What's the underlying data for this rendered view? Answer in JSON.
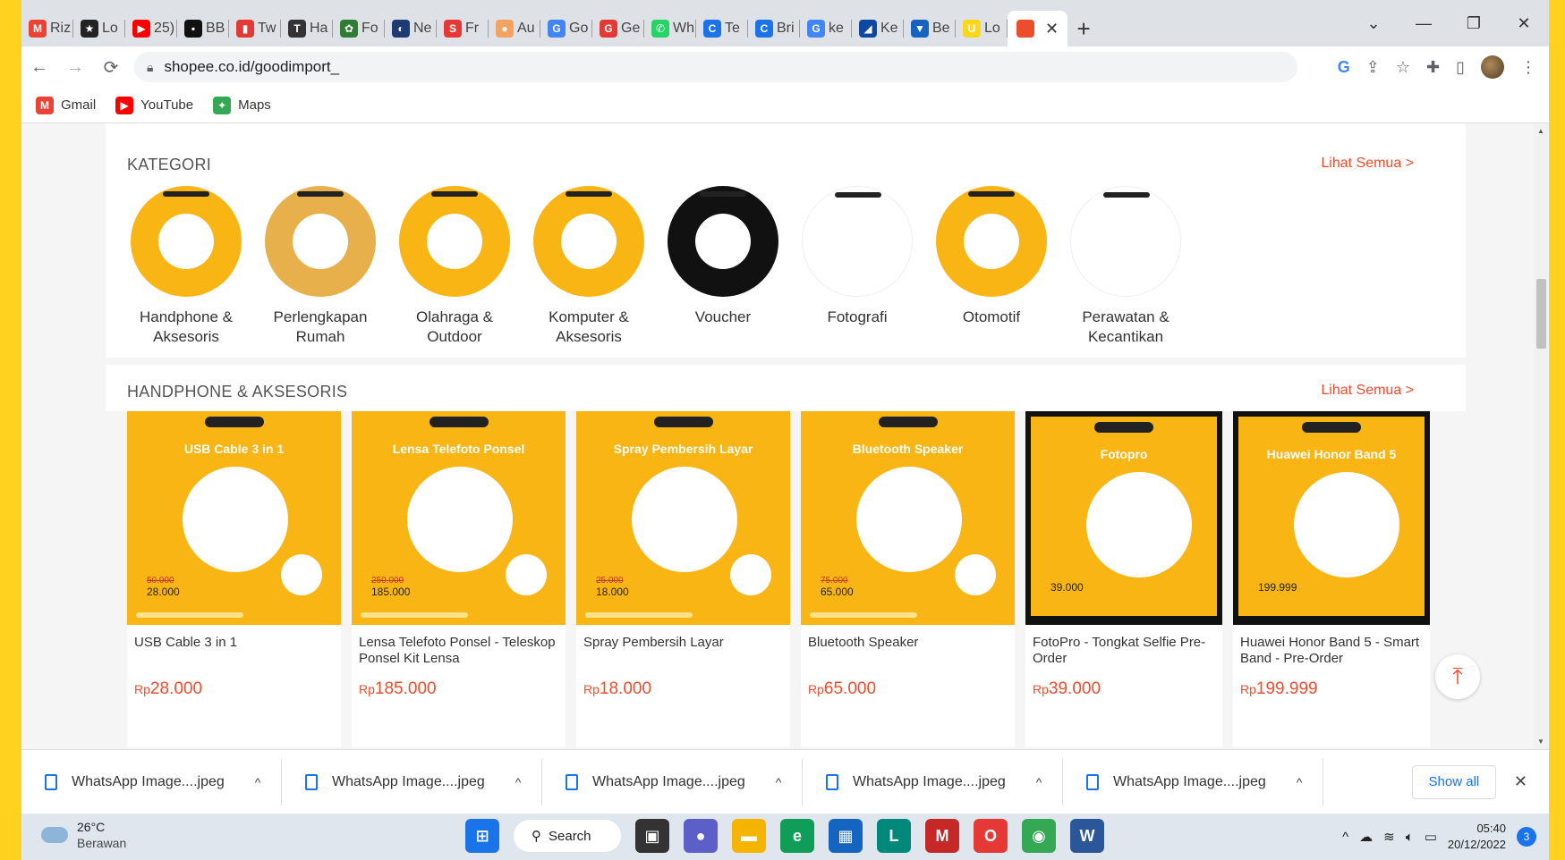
{
  "browser": {
    "tabs": [
      {
        "label": "Riz",
        "icon": "gmail-icon",
        "color": "#EA4335",
        "glyph": "M"
      },
      {
        "label": "Lo",
        "icon": "star-icon",
        "color": "#222222",
        "glyph": "★"
      },
      {
        "label": "25)",
        "icon": "youtube-icon",
        "color": "#FF0000",
        "glyph": "▶"
      },
      {
        "label": "BB",
        "icon": "bbc-icon",
        "color": "#111111",
        "glyph": "▪"
      },
      {
        "label": "Tw",
        "icon": "chart-icon",
        "color": "#E53935",
        "glyph": "▮"
      },
      {
        "label": "Ha",
        "icon": "t-icon",
        "color": "#333333",
        "glyph": "T"
      },
      {
        "label": "Fo",
        "icon": "fo-icon",
        "color": "#2E7D32",
        "glyph": "✿"
      },
      {
        "label": "Ne",
        "icon": "ne-icon",
        "color": "#1F3B73",
        "glyph": "◐"
      },
      {
        "label": "Fr",
        "icon": "s-icon",
        "color": "#E53935",
        "glyph": "S"
      },
      {
        "label": "Au",
        "icon": "au-icon",
        "color": "#F4A261",
        "glyph": "●"
      },
      {
        "label": "Go",
        "icon": "translate-icon",
        "color": "#4285F4",
        "glyph": "G"
      },
      {
        "label": "Ge",
        "icon": "ge-icon",
        "color": "#E53935",
        "glyph": "G"
      },
      {
        "label": "Wh",
        "icon": "whatsapp-icon",
        "color": "#25D366",
        "glyph": "✆"
      },
      {
        "label": "Te",
        "icon": "te-icon",
        "color": "#1A73E8",
        "glyph": "C"
      },
      {
        "label": "Bri",
        "icon": "bri-icon",
        "color": "#1A73E8",
        "glyph": "C"
      },
      {
        "label": "ke",
        "icon": "google-icon",
        "color": "#4285F4",
        "glyph": "G"
      },
      {
        "label": "Ke",
        "icon": "ke-icon",
        "color": "#0D47A1",
        "glyph": "◢"
      },
      {
        "label": "Be",
        "icon": "be-icon",
        "color": "#1565C0",
        "glyph": "▼"
      },
      {
        "label": "Lo",
        "icon": "lo-icon",
        "color": "#F9D71C",
        "glyph": "U"
      }
    ],
    "active_tab": {
      "icon": "shopee-icon",
      "color": "#EE4D2D"
    },
    "url": "shopee.co.id/goodimport_",
    "bookmarks": [
      {
        "label": "Gmail",
        "icon": "gmail-icon",
        "color": "#EA4335",
        "glyph": "M"
      },
      {
        "label": "YouTube",
        "icon": "youtube-icon",
        "color": "#FF0000",
        "glyph": "▶"
      },
      {
        "label": "Maps",
        "icon": "maps-icon",
        "color": "#34A853",
        "glyph": "✦"
      }
    ]
  },
  "kategori": {
    "title": "KATEGORI",
    "more": "Lihat Semua >",
    "items": [
      {
        "line1": "Handphone &",
        "line2": "Aksesoris",
        "bg": "#F9B514"
      },
      {
        "line1": "Perlengkapan",
        "line2": "Rumah",
        "bg": "#E7B04A"
      },
      {
        "line1": "Olahraga &",
        "line2": "Outdoor",
        "bg": "#F9B514"
      },
      {
        "line1": "Komputer &",
        "line2": "Aksesoris",
        "bg": "#F9B514"
      },
      {
        "line1": "Voucher",
        "line2": "",
        "bg": "#111111"
      },
      {
        "line1": "Fotografi",
        "line2": "",
        "bg": "#FFFFFF"
      },
      {
        "line1": "Otomotif",
        "line2": "",
        "bg": "#F9B514"
      },
      {
        "line1": "Perawatan &",
        "line2": "Kecantikan",
        "bg": "#FFFFFF"
      }
    ]
  },
  "products_section": {
    "title": "HANDPHONE & AKSESORIS",
    "more": "Lihat Semua >",
    "items": [
      {
        "img_title": "USB Cable 3 in 1",
        "old": "50.000",
        "new": "28.000",
        "name": "USB Cable 3 in 1",
        "currency": "Rp",
        "price": "28.000",
        "framed": false
      },
      {
        "img_title": "Lensa Telefoto Ponsel",
        "old": "250.000",
        "new": "185.000",
        "name": "Lensa Telefoto Ponsel - Teleskop Ponsel Kit Lensa",
        "currency": "Rp",
        "price": "185.000",
        "framed": false
      },
      {
        "img_title": "Spray Pembersih Layar",
        "old": "25.000",
        "new": "18.000",
        "name": "Spray Pembersih Layar",
        "currency": "Rp",
        "price": "18.000",
        "framed": false
      },
      {
        "img_title": "Bluetooth Speaker",
        "old": "75.000",
        "new": "65.000",
        "name": "Bluetooth Speaker",
        "currency": "Rp",
        "price": "65.000",
        "framed": false
      },
      {
        "img_title": "Fotopro",
        "old": "",
        "new": "39.000",
        "name": "FotoPro - Tongkat Selfie Pre-Order",
        "currency": "Rp",
        "price": "39.000",
        "framed": true
      },
      {
        "img_title": "Huawei Honor Band 5",
        "old": "",
        "new": "199.999",
        "name": "Huawei Honor Band 5 - Smart Band - Pre-Order",
        "currency": "Rp",
        "price": "199.999",
        "framed": true
      }
    ]
  },
  "downloads": {
    "files": [
      "WhatsApp Image....jpeg",
      "WhatsApp Image....jpeg",
      "WhatsApp Image....jpeg",
      "WhatsApp Image....jpeg",
      "WhatsApp Image....jpeg"
    ],
    "show_all": "Show all"
  },
  "taskbar": {
    "temp": "26°C",
    "weather": "Berawan",
    "search": "Search",
    "time": "05:40",
    "date": "20/12/2022",
    "notifications": "3",
    "apps": [
      {
        "name": "windows-start-icon",
        "color": "#1A73E8",
        "glyph": "⊞"
      },
      {
        "name": "task-view-icon",
        "color": "#333333",
        "glyph": "▣"
      },
      {
        "name": "chat-icon",
        "color": "#5B5FC7",
        "glyph": "●"
      },
      {
        "name": "file-explorer-icon",
        "color": "#F4B400",
        "glyph": "▬"
      },
      {
        "name": "edge-icon",
        "color": "#0F9D58",
        "glyph": "e"
      },
      {
        "name": "store-icon",
        "color": "#1565C0",
        "glyph": "▦"
      },
      {
        "name": "l-app-icon",
        "color": "#00897B",
        "glyph": "L"
      },
      {
        "name": "mcafee-icon",
        "color": "#C62828",
        "glyph": "M"
      },
      {
        "name": "opera-icon",
        "color": "#E53935",
        "glyph": "O"
      },
      {
        "name": "chrome-icon",
        "color": "#34A853",
        "glyph": "◉"
      },
      {
        "name": "word-icon",
        "color": "#2B579A",
        "glyph": "W"
      }
    ]
  }
}
